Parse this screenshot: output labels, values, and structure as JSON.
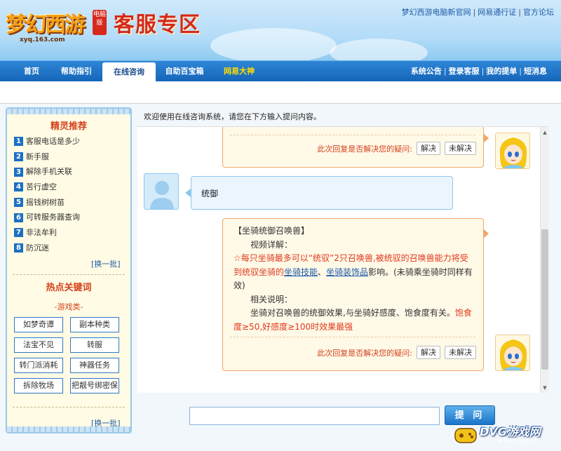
{
  "brand": {
    "logo_text": "梦幻西游",
    "logo_badge": "电脑版",
    "logo_url": "xyq.163.com",
    "page_title": "客服专区"
  },
  "top_links": [
    "梦幻西游电脑新官网",
    "网易通行证",
    "官方论坛"
  ],
  "nav": {
    "items": [
      "首页",
      "帮助指引",
      "在线咨询",
      "自助百宝箱",
      "网易大神"
    ],
    "active": "在线咨询",
    "right_links": [
      "系统公告",
      "登录客服",
      "我的提单",
      "短消息"
    ]
  },
  "sidebar": {
    "recommend_title": "精灵推荐",
    "recommend_items": [
      {
        "num": "1",
        "label": "客服电话是多少"
      },
      {
        "num": "2",
        "label": "新手服"
      },
      {
        "num": "3",
        "label": "解除手机关联"
      },
      {
        "num": "4",
        "label": "苦行虚空"
      },
      {
        "num": "5",
        "label": "摇钱树树苗"
      },
      {
        "num": "6",
        "label": "可转服务器查询"
      },
      {
        "num": "7",
        "label": "非法牟利"
      },
      {
        "num": "8",
        "label": "防沉迷"
      }
    ],
    "refresh_label": "[换一批]",
    "keywords_title": "热点关键词",
    "category_label": "-游戏类-",
    "keywords": [
      "如梦奇谭",
      "副本种类",
      "法宝不见",
      "转服",
      "转门派消耗",
      "神器任务",
      "拆除牧场",
      "把靓号绑密保"
    ],
    "refresh_label_2": "[换一批]"
  },
  "chat": {
    "welcome": "欢迎使用在线咨询系统，请您在下方输入提问内容。",
    "feedback_question": "此次回复是否解决您的疑问:",
    "resolved_label": "解决",
    "unresolved_label": "未解决",
    "user_message": "统御",
    "reply": {
      "title": "【坐骑统御召唤兽】",
      "video_label": "视频详解：",
      "line1_red": "☆每只坐骑最多可以“统驭”2只召唤兽,被统驭的召唤兽能力将受到统驭坐骑的",
      "link1": "坐骑技能",
      "sep": "、",
      "link2": "坐骑装饰品",
      "line1_tail": "影响。(未骑乘坐骑时同样有效)",
      "related_label": "相关说明：",
      "line2": "坐骑对召唤兽的统御效果,与坐骑好感度、饱食度有关。",
      "line2_red": "饱食度≥50,好感度≥100时效果最强"
    }
  },
  "input": {
    "value": "",
    "ask_label": "提 问"
  },
  "watermark": {
    "text": "DVG游戏网",
    "url": "www.dvg.cn"
  }
}
